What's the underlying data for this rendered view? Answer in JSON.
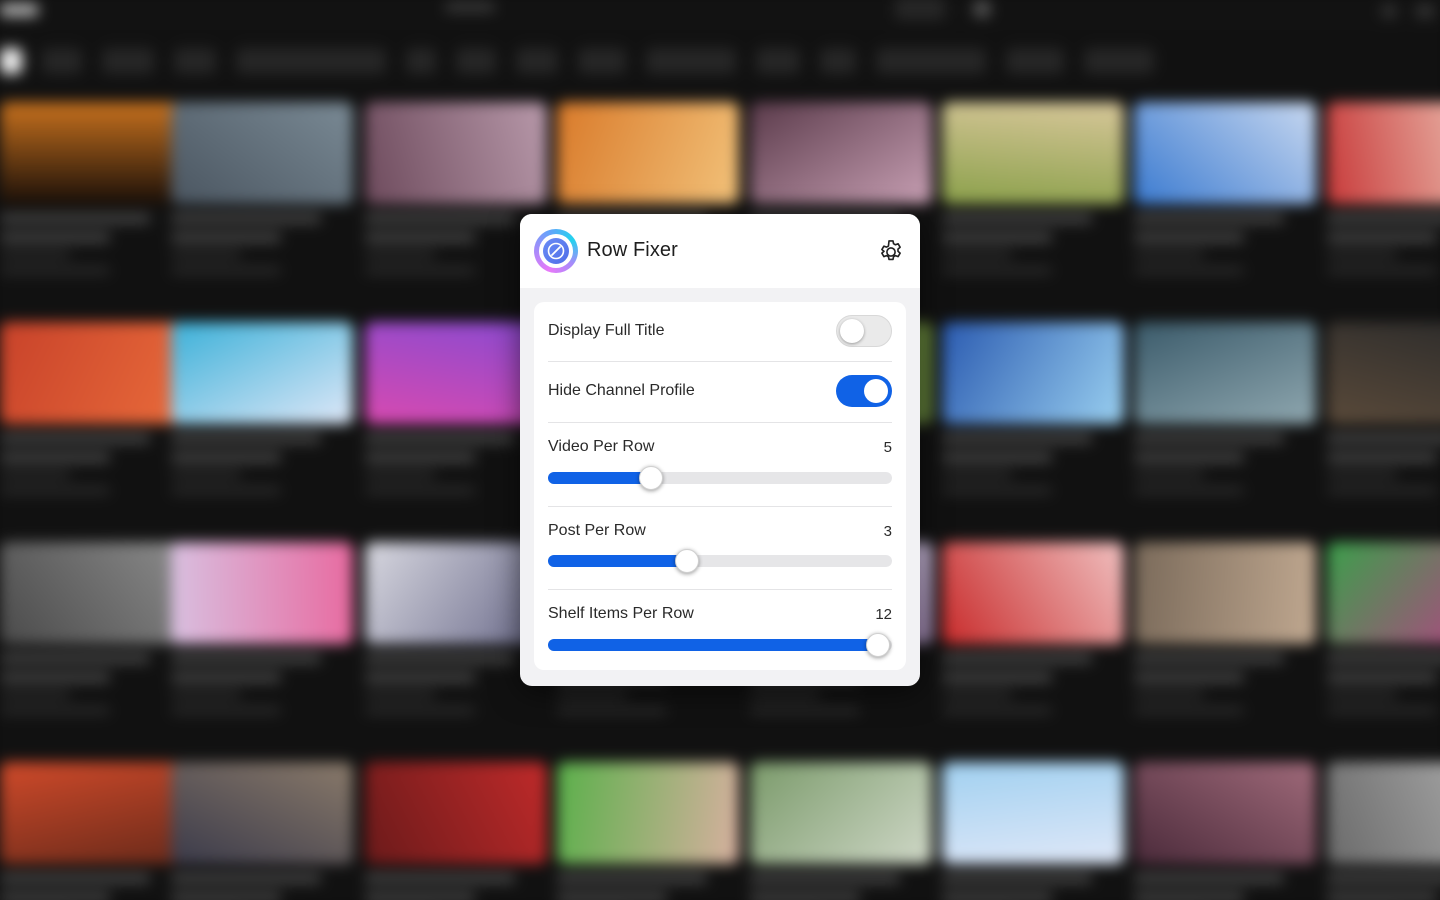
{
  "popup": {
    "title": "Row Fixer",
    "settings_icon": "gear-icon",
    "logo_icon": "compass-icon",
    "accent_color": "#1062e6"
  },
  "settings": {
    "toggles": [
      {
        "label": "Display Full Title",
        "enabled": false
      },
      {
        "label": "Hide Channel Profile",
        "enabled": true
      }
    ],
    "sliders": [
      {
        "label": "Video Per Row",
        "value": "5",
        "fraction": 0.3
      },
      {
        "label": "Post Per Row",
        "value": "3",
        "fraction": 0.405
      },
      {
        "label": "Shelf Items Per Row",
        "value": "12",
        "fraction": 0.96
      }
    ]
  }
}
